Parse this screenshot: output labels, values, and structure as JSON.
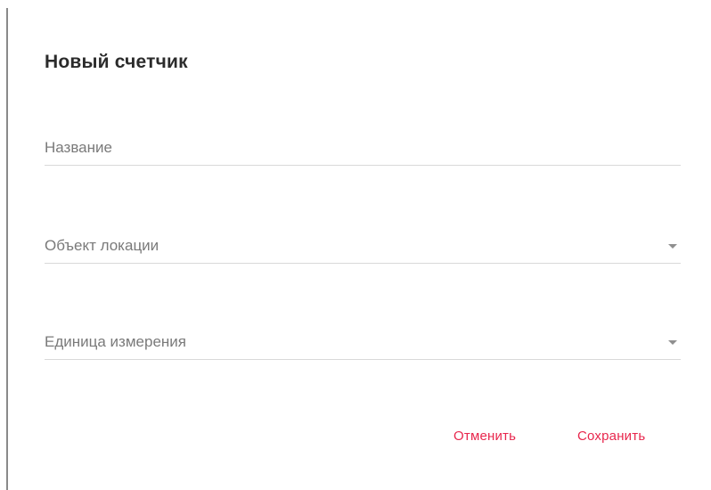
{
  "dialog": {
    "title": "Новый счетчик",
    "fields": {
      "name": {
        "label": "Название"
      },
      "location_object": {
        "label": "Объект локации",
        "icon": "chevron-down-icon"
      },
      "unit": {
        "label": "Единица измерения",
        "icon": "chevron-down-icon"
      }
    },
    "actions": {
      "cancel_label": "Отменить",
      "save_label": "Сохранить"
    },
    "accent_color": "#e8274d"
  }
}
